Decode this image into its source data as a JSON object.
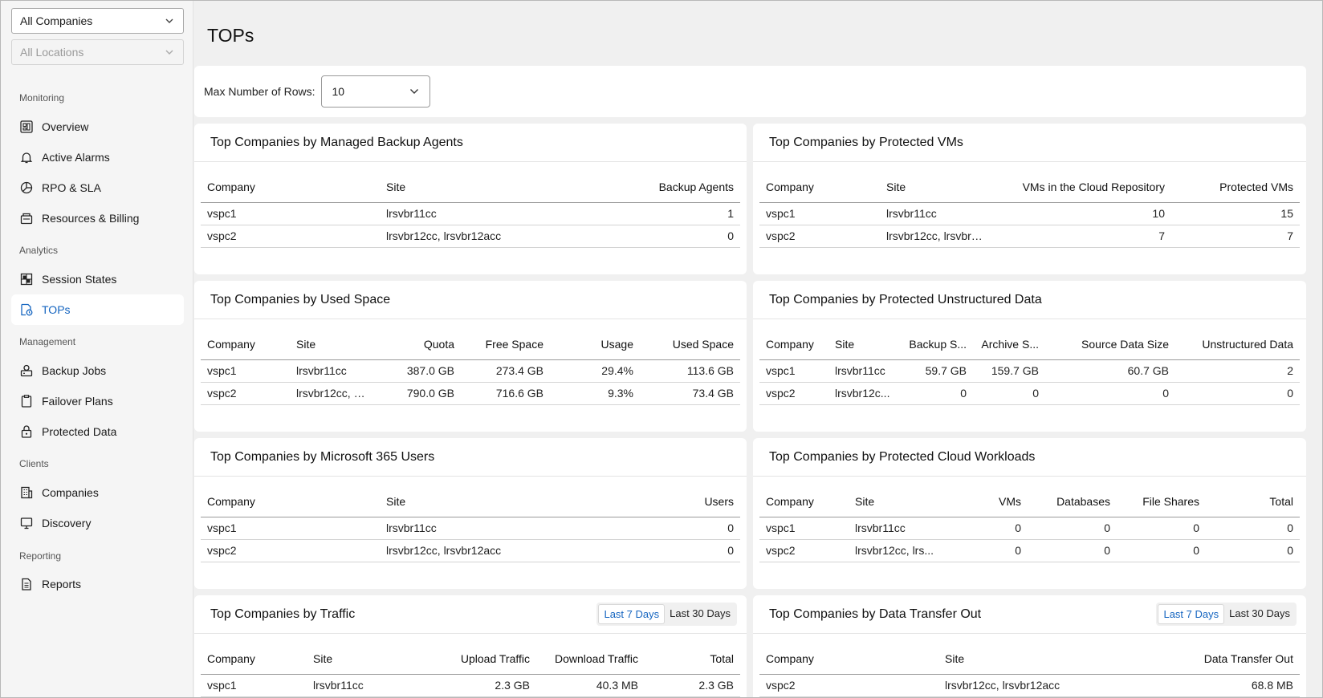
{
  "sidebar": {
    "company_select": "All Companies",
    "location_select": "All Locations",
    "sections": {
      "monitoring": "Monitoring",
      "analytics": "Analytics",
      "management": "Management",
      "clients": "Clients",
      "reporting": "Reporting"
    },
    "items": {
      "overview": "Overview",
      "active_alarms": "Active Alarms",
      "rpo_sla": "RPO & SLA",
      "resources_billing": "Resources & Billing",
      "session_states": "Session States",
      "tops": "TOPs",
      "backup_jobs": "Backup Jobs",
      "failover_plans": "Failover Plans",
      "protected_data": "Protected Data",
      "companies": "Companies",
      "discovery": "Discovery",
      "reports": "Reports"
    },
    "active_item": "tops",
    "accent_color": "#1565c0"
  },
  "page": {
    "title": "TOPs",
    "max_rows_label": "Max Number of Rows:",
    "max_rows_value": "10"
  },
  "cards": {
    "backup_agents": {
      "title": "Top Companies by Managed Backup Agents",
      "headers": [
        "Company",
        "Site",
        "Backup Agents"
      ],
      "rows": [
        [
          "vspc1",
          "lrsvbr11cc",
          "1"
        ],
        [
          "vspc2",
          "lrsvbr12cc, lrsvbr12acc",
          "0"
        ]
      ]
    },
    "protected_vms": {
      "title": "Top Companies by Protected VMs",
      "headers": [
        "Company",
        "Site",
        "VMs in the Cloud Repository",
        "Protected VMs"
      ],
      "rows": [
        [
          "vspc1",
          "lrsvbr11cc",
          "10",
          "15"
        ],
        [
          "vspc2",
          "lrsvbr12cc, lrsvbr12...",
          "7",
          "7"
        ]
      ]
    },
    "used_space": {
      "title": "Top Companies by Used Space",
      "headers": [
        "Company",
        "Site",
        "Quota",
        "Free Space",
        "Usage",
        "Used Space"
      ],
      "rows": [
        [
          "vspc1",
          "lrsvbr11cc",
          "387.0 GB",
          "273.4 GB",
          "29.4%",
          "113.6 GB"
        ],
        [
          "vspc2",
          "lrsvbr12cc, lrs...",
          "790.0 GB",
          "716.6 GB",
          "9.3%",
          "73.4 GB"
        ]
      ]
    },
    "unstructured": {
      "title": "Top Companies by Protected Unstructured Data",
      "headers": [
        "Company",
        "Site",
        "Backup S...",
        "Archive S...",
        "Source Data Size",
        "Unstructured Data"
      ],
      "rows": [
        [
          "vspc1",
          "lrsvbr11cc",
          "59.7 GB",
          "159.7 GB",
          "60.7 GB",
          "2"
        ],
        [
          "vspc2",
          "lrsvbr12c...",
          "0",
          "0",
          "0",
          "0"
        ]
      ]
    },
    "m365": {
      "title": "Top Companies by Microsoft 365 Users",
      "headers": [
        "Company",
        "Site",
        "Users"
      ],
      "rows": [
        [
          "vspc1",
          "lrsvbr11cc",
          "0"
        ],
        [
          "vspc2",
          "lrsvbr12cc, lrsvbr12acc",
          "0"
        ]
      ]
    },
    "cloud_workloads": {
      "title": "Top Companies by Protected Cloud Workloads",
      "headers": [
        "Company",
        "Site",
        "VMs",
        "Databases",
        "File Shares",
        "Total"
      ],
      "rows": [
        [
          "vspc1",
          "lrsvbr11cc",
          "0",
          "0",
          "0",
          "0"
        ],
        [
          "vspc2",
          "lrsvbr12cc, lrs...",
          "0",
          "0",
          "0",
          "0"
        ]
      ]
    },
    "traffic": {
      "title": "Top Companies by Traffic",
      "toggle": [
        "Last 7 Days",
        "Last 30 Days"
      ],
      "headers": [
        "Company",
        "Site",
        "Upload Traffic",
        "Download Traffic",
        "Total"
      ],
      "rows": [
        [
          "vspc1",
          "lrsvbr11cc",
          "2.3 GB",
          "40.3 MB",
          "2.3 GB"
        ]
      ]
    },
    "transfer_out": {
      "title": "Top Companies by Data Transfer Out",
      "toggle": [
        "Last 7 Days",
        "Last 30 Days"
      ],
      "headers": [
        "Company",
        "Site",
        "Data Transfer Out"
      ],
      "rows": [
        [
          "vspc2",
          "lrsvbr12cc, lrsvbr12acc",
          "68.8 MB"
        ]
      ]
    }
  }
}
